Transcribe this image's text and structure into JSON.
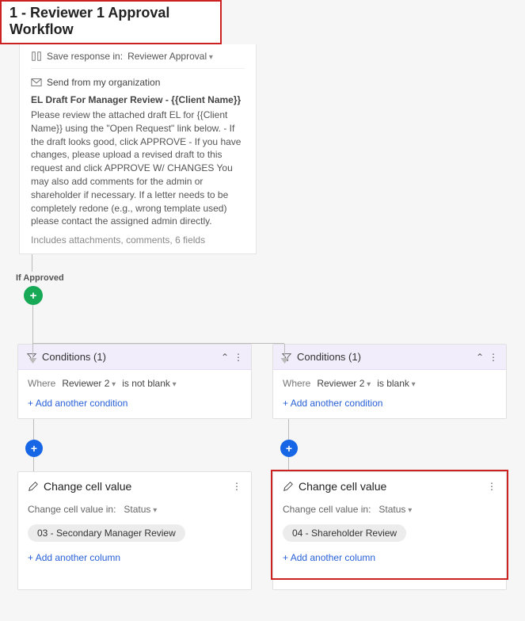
{
  "title": "1 - Reviewer 1 Approval Workflow",
  "topCard": {
    "saveResponseLabel": "Save response in:",
    "saveResponseValue": "Reviewer Approval",
    "sendLabel": "Send from my organization",
    "subject": "EL Draft For Manager Review - {{Client Name}}",
    "body": "Please review the attached draft EL for {{Client Name}} using the \"Open Request\" link below. - If the draft looks good, click APPROVE - If you have changes, please upload a revised draft to this request and click APPROVE W/ CHANGES You may also add comments for the admin or shareholder if necessary. If a letter needs to be completely redone (e.g., wrong template used) please contact the assigned admin directly.",
    "meta": "Includes attachments, comments, 6 fields"
  },
  "branchLabel": "If Approved",
  "left": {
    "conditionsTitle": "Conditions (1)",
    "whereLabel": "Where",
    "field": "Reviewer 2",
    "op": "is not blank",
    "addCondition": "Add another condition",
    "actionTitle": "Change cell value",
    "changeLabel": "Change cell value in:",
    "changeField": "Status",
    "chip": "03 - Secondary Manager Review",
    "addColumn": "Add another column"
  },
  "right": {
    "conditionsTitle": "Conditions (1)",
    "whereLabel": "Where",
    "field": "Reviewer 2",
    "op": "is blank",
    "addCondition": "Add another condition",
    "actionTitle": "Change cell value",
    "changeLabel": "Change cell value in:",
    "changeField": "Status",
    "chip": "04 - Shareholder Review",
    "addColumn": "Add another column"
  }
}
